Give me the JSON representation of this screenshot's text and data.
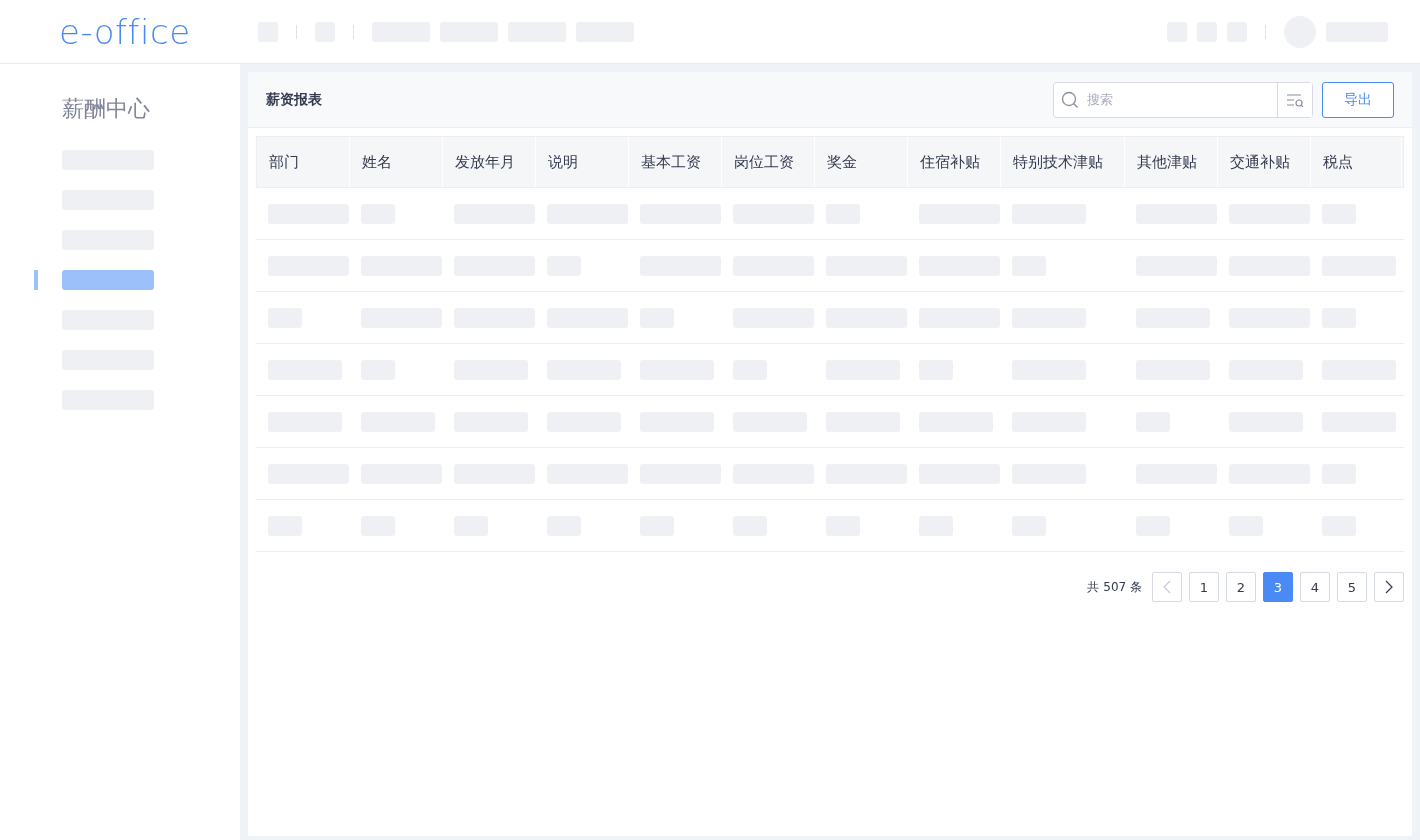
{
  "logo": "e-office",
  "sidebar": {
    "title": "薪酬中心",
    "items": [
      {
        "selected": false
      },
      {
        "selected": false
      },
      {
        "selected": false
      },
      {
        "selected": true
      },
      {
        "selected": false
      },
      {
        "selected": false
      },
      {
        "selected": false
      }
    ]
  },
  "panel": {
    "title": "薪资报表",
    "search": {
      "placeholder": "搜索"
    },
    "export_button": "导出"
  },
  "table": {
    "columns": [
      "部门",
      "姓名",
      "发放年月",
      "说明",
      "基本工资",
      "岗位工资",
      "奖金",
      "住宿补贴",
      "特别技术津贴",
      "其他津贴",
      "交通补贴",
      "税点"
    ]
  },
  "pagination": {
    "total": "共 507 条",
    "prev_disabled": true,
    "next_disabled": false,
    "pages": [
      {
        "label": "1",
        "selected": false
      },
      {
        "label": "2",
        "selected": false
      },
      {
        "label": "3",
        "selected": true
      },
      {
        "label": "4",
        "selected": false
      },
      {
        "label": "5",
        "selected": false
      }
    ]
  }
}
